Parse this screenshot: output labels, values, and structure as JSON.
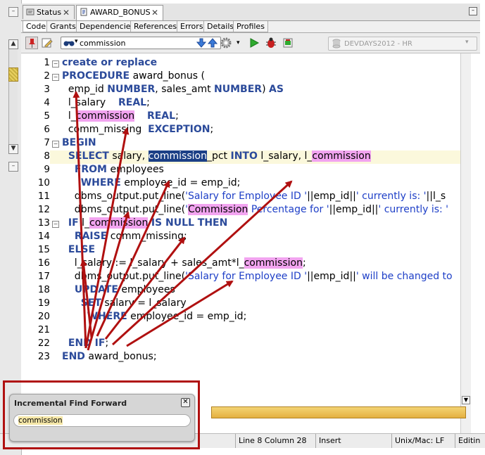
{
  "tabs": [
    {
      "label": "Status"
    },
    {
      "label": "AWARD_BONUS"
    }
  ],
  "subtabs": [
    "Code",
    "Grants",
    "Dependencies",
    "References",
    "Errors",
    "Details",
    "Profiles"
  ],
  "toolbar": {
    "search_value": "commission",
    "connection": "DEVDAYS2012 - HR"
  },
  "editor": {
    "line_numbers": [
      "1",
      "2",
      "3",
      "4",
      "5",
      "6",
      "7",
      "8",
      "9",
      "10",
      "11",
      "12",
      "13",
      "14",
      "15",
      "16",
      "17",
      "18",
      "19",
      "20",
      "21",
      "22",
      "23"
    ],
    "lines": [
      [
        {
          "t": "create or replace",
          "c": "kw"
        }
      ],
      [
        {
          "t": "PROCEDURE",
          "c": "kw"
        },
        {
          "t": " award_bonus (",
          "c": ""
        }
      ],
      [
        {
          "t": "  emp_id ",
          "c": ""
        },
        {
          "t": "NUMBER",
          "c": "kw"
        },
        {
          "t": ", sales_amt ",
          "c": ""
        },
        {
          "t": "NUMBER",
          "c": "kw"
        },
        {
          "t": ") ",
          "c": ""
        },
        {
          "t": "AS",
          "c": "kw"
        }
      ],
      [
        {
          "t": "  l_salary    ",
          "c": ""
        },
        {
          "t": "REAL",
          "c": "kw"
        },
        {
          "t": ";",
          "c": ""
        }
      ],
      [
        {
          "t": "  l_",
          "c": ""
        },
        {
          "t": "commission",
          "c": "hl"
        },
        {
          "t": "    ",
          "c": ""
        },
        {
          "t": "REAL",
          "c": "kw"
        },
        {
          "t": ";",
          "c": ""
        }
      ],
      [
        {
          "t": "  comm_missing  ",
          "c": ""
        },
        {
          "t": "EXCEPTION",
          "c": "kw"
        },
        {
          "t": ";",
          "c": ""
        }
      ],
      [
        {
          "t": "BEGIN",
          "c": "kw"
        }
      ],
      [
        {
          "t": "  ",
          "c": ""
        },
        {
          "t": "SELECT",
          "c": "kw"
        },
        {
          "t": " salary, ",
          "c": ""
        },
        {
          "t": "commission",
          "c": "hlsel"
        },
        {
          "t": "_pct ",
          "c": ""
        },
        {
          "t": "INTO",
          "c": "kw"
        },
        {
          "t": " l_salary, l_",
          "c": ""
        },
        {
          "t": "commission",
          "c": "hl"
        }
      ],
      [
        {
          "t": "    ",
          "c": ""
        },
        {
          "t": "FROM",
          "c": "kw"
        },
        {
          "t": " employees",
          "c": ""
        }
      ],
      [
        {
          "t": "      ",
          "c": ""
        },
        {
          "t": "WHERE",
          "c": "kw"
        },
        {
          "t": " employee_id = emp_id;",
          "c": ""
        }
      ],
      [
        {
          "t": "    dbms_output.put_line(",
          "c": ""
        },
        {
          "t": "'Salary for Employee ID '",
          "c": "str"
        },
        {
          "t": "||emp_id||",
          "c": ""
        },
        {
          "t": "' currently is: '",
          "c": "str"
        },
        {
          "t": "||l_s",
          "c": ""
        }
      ],
      [
        {
          "t": "    dbms_output.put_line(",
          "c": ""
        },
        {
          "t": "'",
          "c": "str"
        },
        {
          "t": "Commission",
          "c": "hl"
        },
        {
          "t": " Percentage for '",
          "c": "str"
        },
        {
          "t": "||emp_id||",
          "c": ""
        },
        {
          "t": "' currently is: '",
          "c": "str"
        }
      ],
      [
        {
          "t": "  ",
          "c": ""
        },
        {
          "t": "IF",
          "c": "kw"
        },
        {
          "t": " l_",
          "c": ""
        },
        {
          "t": "commission",
          "c": "hl"
        },
        {
          "t": " ",
          "c": ""
        },
        {
          "t": "IS NULL THEN",
          "c": "kw"
        }
      ],
      [
        {
          "t": "    ",
          "c": ""
        },
        {
          "t": "RAISE",
          "c": "kw"
        },
        {
          "t": " comm_missing;",
          "c": ""
        }
      ],
      [
        {
          "t": "  ",
          "c": ""
        },
        {
          "t": "ELSE",
          "c": "kw"
        }
      ],
      [
        {
          "t": "    l_salary := l_salary + sales_amt*l_",
          "c": ""
        },
        {
          "t": "commission",
          "c": "hl"
        },
        {
          "t": ";",
          "c": ""
        }
      ],
      [
        {
          "t": "    dbms_output.put_line(",
          "c": ""
        },
        {
          "t": "'Salary for Employee ID '",
          "c": "str"
        },
        {
          "t": "||emp_id||",
          "c": ""
        },
        {
          "t": "' will be changed to",
          "c": "str"
        }
      ],
      [
        {
          "t": "    ",
          "c": ""
        },
        {
          "t": "UPDATE",
          "c": "kw"
        },
        {
          "t": " employees",
          "c": ""
        }
      ],
      [
        {
          "t": "      ",
          "c": ""
        },
        {
          "t": "SET",
          "c": "kw"
        },
        {
          "t": " salary = l_salary",
          "c": ""
        }
      ],
      [
        {
          "t": "        ",
          "c": ""
        },
        {
          "t": "WHERE",
          "c": "kw"
        },
        {
          "t": " employee_id = emp_id;",
          "c": ""
        }
      ],
      [
        {
          "t": "",
          "c": ""
        }
      ],
      [
        {
          "t": "  ",
          "c": ""
        },
        {
          "t": "END IF",
          "c": "kw"
        },
        {
          "t": ";",
          "c": ""
        }
      ],
      [
        {
          "t": "END",
          "c": "kw"
        },
        {
          "t": " award_bonus;",
          "c": ""
        }
      ]
    ]
  },
  "statusbar": {
    "position": "Line 8 Column 28",
    "mode": "Insert",
    "eol": "Unix/Mac: LF",
    "edit": "Editin"
  },
  "find_popup": {
    "title": "Incremental Find Forward",
    "value": "commission"
  },
  "colors": {
    "keyword": "#2b4a9a",
    "string": "#1e3fc7",
    "match_highlight": "#f2a4f0",
    "current_match": "#1b3f86",
    "annotation_red": "#b01010",
    "current_line": "#fbf8dc"
  }
}
